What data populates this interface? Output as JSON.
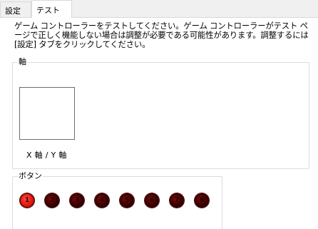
{
  "tabs": [
    {
      "label": "設定"
    },
    {
      "label": "テスト"
    }
  ],
  "description": "ゲーム コントローラーをテストしてください。ゲーム コントローラーがテスト ページで正しく機能しない場合は調整が必要である可能性があります。調整するには [設定] タブをクリックしてください。",
  "axis_group": {
    "title": "軸",
    "xy_label": "X 軸 / Y 軸"
  },
  "button_group": {
    "title": "ボタン",
    "buttons": [
      {
        "number": "1",
        "pressed": true
      },
      {
        "number": "2",
        "pressed": false
      },
      {
        "number": "3",
        "pressed": false
      },
      {
        "number": "4",
        "pressed": false
      },
      {
        "number": "5",
        "pressed": false
      },
      {
        "number": "6",
        "pressed": false
      },
      {
        "number": "7",
        "pressed": false
      },
      {
        "number": "8",
        "pressed": false
      }
    ]
  },
  "colors": {
    "pressed": "#e21a12",
    "released": "#3a0000"
  }
}
